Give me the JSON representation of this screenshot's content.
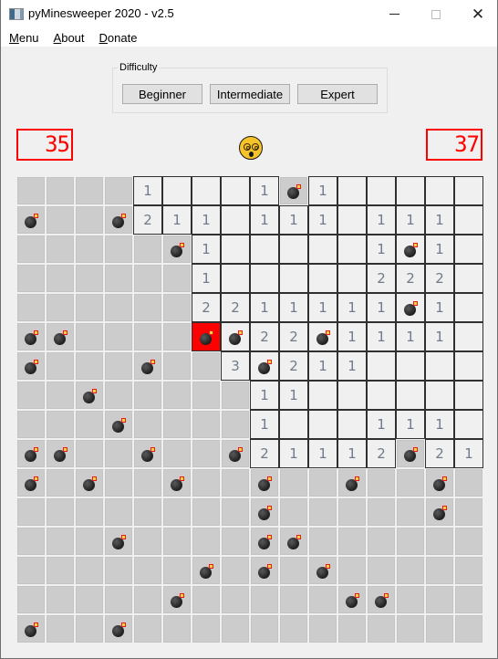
{
  "window": {
    "title": "pyMinesweeper 2020 - v2.5",
    "controls": {
      "minimize_icon": "minimize-icon",
      "maximize_icon": "maximize-icon",
      "close_icon": "close-icon"
    }
  },
  "menu": {
    "items": [
      {
        "label": "Menu"
      },
      {
        "label": "About"
      },
      {
        "label": "Donate"
      }
    ]
  },
  "difficulty": {
    "group_label": "Difficulty",
    "buttons": [
      {
        "label": "Beginner"
      },
      {
        "label": "Intermediate"
      },
      {
        "label": "Expert"
      }
    ]
  },
  "status": {
    "mine_counter": "35",
    "timer": "37",
    "face": "dizzy-face-icon",
    "lcd_color": "#ff0000"
  },
  "board": {
    "rows": 16,
    "cols": 16,
    "legend": {
      "H": "hidden",
      "B": "hidden-bomb",
      "0": "revealed-empty",
      "1-8": "revealed-number",
      "M": "revealed-bomb",
      "X": "exploded-bomb"
    },
    "grid": [
      [
        "H",
        "H",
        "H",
        "H",
        "1",
        "0",
        "0",
        "0",
        "1",
        "B",
        "1",
        "0",
        "0",
        "0",
        "0",
        "0"
      ],
      [
        "B",
        "H",
        "H",
        "B",
        "2",
        "1",
        "1",
        "0",
        "1",
        "1",
        "1",
        "0",
        "1",
        "1",
        "1",
        "0"
      ],
      [
        "H",
        "H",
        "H",
        "H",
        "H",
        "B",
        "1",
        "0",
        "0",
        "0",
        "0",
        "0",
        "1",
        "M",
        "1",
        "0"
      ],
      [
        "H",
        "H",
        "H",
        "H",
        "H",
        "H",
        "1",
        "0",
        "0",
        "0",
        "0",
        "0",
        "2",
        "2",
        "2",
        "0"
      ],
      [
        "H",
        "H",
        "H",
        "H",
        "H",
        "H",
        "2",
        "2",
        "1",
        "1",
        "1",
        "1",
        "1",
        "M",
        "1",
        "0"
      ],
      [
        "B",
        "B",
        "H",
        "H",
        "H",
        "H",
        "X",
        "M",
        "2",
        "2",
        "M",
        "1",
        "1",
        "1",
        "1",
        "0"
      ],
      [
        "B",
        "H",
        "H",
        "H",
        "B",
        "H",
        "H",
        "3",
        "M",
        "2",
        "1",
        "1",
        "0",
        "0",
        "0",
        "0"
      ],
      [
        "H",
        "H",
        "B",
        "H",
        "H",
        "H",
        "H",
        "H",
        "1",
        "1",
        "0",
        "0",
        "0",
        "0",
        "0",
        "0"
      ],
      [
        "H",
        "H",
        "H",
        "B",
        "H",
        "H",
        "H",
        "H",
        "1",
        "0",
        "0",
        "0",
        "1",
        "1",
        "1",
        "0"
      ],
      [
        "B",
        "B",
        "H",
        "H",
        "B",
        "H",
        "H",
        "B",
        "2",
        "1",
        "1",
        "1",
        "2",
        "B",
        "2",
        "1"
      ],
      [
        "B",
        "H",
        "B",
        "H",
        "H",
        "B",
        "H",
        "H",
        "B",
        "H",
        "H",
        "B",
        "H",
        "H",
        "B",
        "H"
      ],
      [
        "H",
        "H",
        "H",
        "H",
        "H",
        "H",
        "H",
        "H",
        "B",
        "H",
        "H",
        "H",
        "H",
        "H",
        "B",
        "H"
      ],
      [
        "H",
        "H",
        "H",
        "B",
        "H",
        "H",
        "H",
        "H",
        "B",
        "B",
        "H",
        "H",
        "H",
        "H",
        "H",
        "H"
      ],
      [
        "H",
        "H",
        "H",
        "H",
        "H",
        "H",
        "B",
        "H",
        "B",
        "H",
        "B",
        "H",
        "H",
        "H",
        "H",
        "H"
      ],
      [
        "H",
        "H",
        "H",
        "H",
        "H",
        "B",
        "H",
        "H",
        "H",
        "H",
        "H",
        "B",
        "B",
        "H",
        "H",
        "H"
      ],
      [
        "B",
        "H",
        "H",
        "B",
        "H",
        "H",
        "H",
        "H",
        "H",
        "H",
        "H",
        "H",
        "H",
        "H",
        "H",
        "H"
      ]
    ],
    "colors": {
      "hidden": "#cccccc",
      "revealed": "#f0f0f0",
      "exploded": "#ff0000",
      "number_text": "#6d7b8d",
      "grid_line": "#303030"
    }
  }
}
